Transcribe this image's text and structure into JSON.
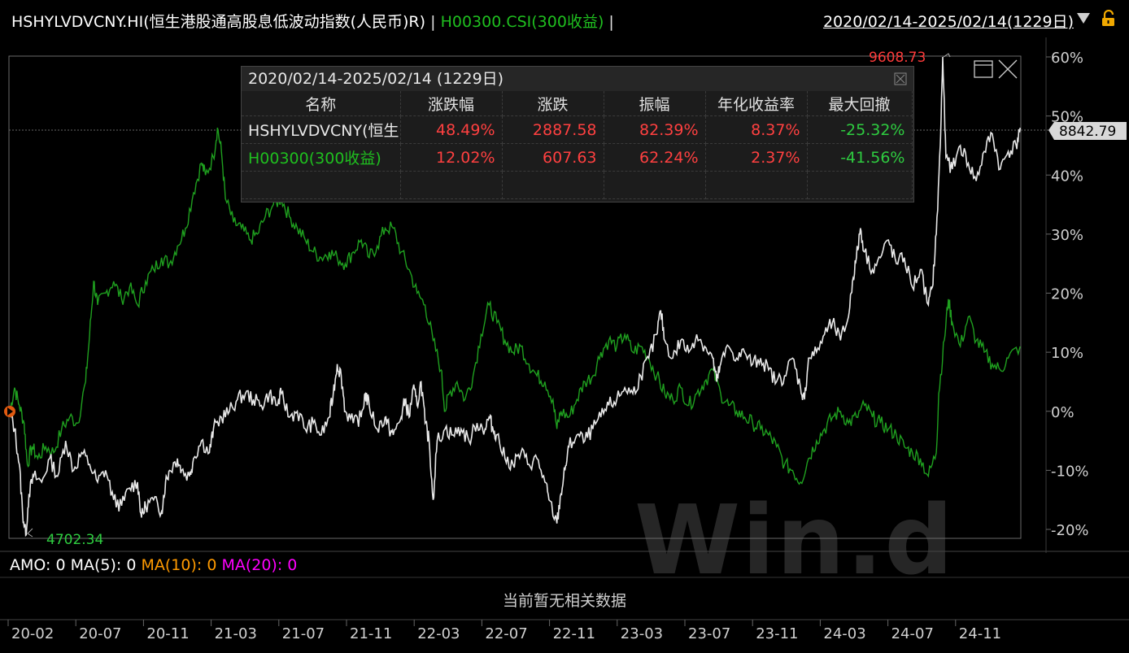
{
  "header": {
    "index_name": "HSHYLVDVCNY.HI(恒生港股通高股息低波动指数(人民币)R)",
    "sep1": "|",
    "benchmark": "H00300.CSI(300收益)",
    "sep2": "|",
    "date_range": "2020/02/14-2025/02/14(1229日)",
    "dropdown_icon": "triangle-down-icon",
    "lock_icon": "unlock-icon"
  },
  "panel": {
    "title": "2020/02/14-2025/02/14 (1229日)",
    "columns": [
      "名称",
      "涨跌幅",
      "涨跌",
      "振幅",
      "年化收益率",
      "最大回撤"
    ],
    "rows": [
      {
        "name": "HSHYLVDVCNY(恒生",
        "change_pct": "48.49%",
        "change": "2887.58",
        "amplitude": "82.39%",
        "annual": "8.37%",
        "max_dd": "-25.32%"
      },
      {
        "name": "H00300(300收益)",
        "change_pct": "12.02%",
        "change": "607.63",
        "amplitude": "62.24%",
        "annual": "2.37%",
        "max_dd": "-41.56%"
      }
    ]
  },
  "annotations": {
    "max_label": "9608.73",
    "min_label": "4702.34",
    "last_value": "8842.79"
  },
  "volume": {
    "amo": "AMO: 0",
    "ma5": "MA(5): 0",
    "ma10": "MA(10): 0",
    "ma20": "MA(20): 0",
    "no_data": "当前暂无相关数据"
  },
  "watermark": "Win.d",
  "colors": {
    "index": "#e8e8e8",
    "benchmark": "#1fa01f",
    "up": "#ff4040",
    "down": "#2ecc40",
    "axis": "#555555"
  },
  "chart_data": {
    "type": "line",
    "y_axis": {
      "min": -20,
      "max": 60,
      "ticks": [
        "60%",
        "50%",
        "40%",
        "30%",
        "20%",
        "10%",
        "0%",
        "-10%",
        "-20%"
      ]
    },
    "x_ticks": [
      "20-02",
      "20-07",
      "20-11",
      "21-03",
      "21-07",
      "21-11",
      "22-03",
      "22-07",
      "22-11",
      "23-03",
      "23-07",
      "23-11",
      "24-03",
      "24-07",
      "24-11"
    ],
    "series": [
      {
        "name": "HSHYLVDVCNY.HI",
        "unit": "%",
        "points": [
          [
            0,
            0
          ],
          [
            0.006,
            -3
          ],
          [
            0.012,
            -9
          ],
          [
            0.016,
            -17
          ],
          [
            0.02,
            -21
          ],
          [
            0.024,
            -14
          ],
          [
            0.03,
            -11
          ],
          [
            0.04,
            -12
          ],
          [
            0.05,
            -8
          ],
          [
            0.06,
            -11
          ],
          [
            0.07,
            -5
          ],
          [
            0.08,
            -10
          ],
          [
            0.09,
            -7
          ],
          [
            0.1,
            -9
          ],
          [
            0.11,
            -12
          ],
          [
            0.12,
            -10
          ],
          [
            0.13,
            -15
          ],
          [
            0.14,
            -16
          ],
          [
            0.15,
            -13
          ],
          [
            0.16,
            -12
          ],
          [
            0.165,
            -18
          ],
          [
            0.17,
            -16
          ],
          [
            0.18,
            -15
          ],
          [
            0.19,
            -17
          ],
          [
            0.195,
            -12
          ],
          [
            0.2,
            -10
          ],
          [
            0.21,
            -8
          ],
          [
            0.215,
            -10
          ],
          [
            0.225,
            -11
          ],
          [
            0.23,
            -8
          ],
          [
            0.24,
            -5
          ],
          [
            0.25,
            -7
          ],
          [
            0.255,
            -3
          ],
          [
            0.265,
            -1
          ],
          [
            0.275,
            0
          ],
          [
            0.285,
            2
          ],
          [
            0.295,
            3
          ],
          [
            0.305,
            2
          ],
          [
            0.315,
            1
          ],
          [
            0.325,
            3
          ],
          [
            0.335,
            1
          ],
          [
            0.34,
            3
          ],
          [
            0.35,
            -1
          ],
          [
            0.36,
            0
          ],
          [
            0.37,
            -3
          ],
          [
            0.38,
            -2
          ],
          [
            0.39,
            -4
          ],
          [
            0.4,
            -1
          ],
          [
            0.405,
            3
          ],
          [
            0.41,
            8
          ],
          [
            0.415,
            6
          ],
          [
            0.42,
            0
          ],
          [
            0.43,
            -2
          ],
          [
            0.44,
            -1
          ],
          [
            0.445,
            3
          ],
          [
            0.45,
            1
          ],
          [
            0.46,
            -3
          ],
          [
            0.47,
            -1
          ],
          [
            0.475,
            -3
          ],
          [
            0.48,
            -4
          ],
          [
            0.49,
            -1
          ],
          [
            0.495,
            2
          ],
          [
            0.5,
            -1
          ],
          [
            0.505,
            4
          ],
          [
            0.51,
            1
          ],
          [
            0.515,
            5
          ],
          [
            0.52,
            -2
          ],
          [
            0.525,
            -5
          ],
          [
            0.53,
            -15
          ],
          [
            0.535,
            -5
          ],
          [
            0.545,
            -3
          ],
          [
            0.555,
            -4
          ],
          [
            0.565,
            -3
          ],
          [
            0.575,
            -5
          ],
          [
            0.585,
            -2
          ],
          [
            0.595,
            -3
          ],
          [
            0.6,
            -1
          ],
          [
            0.605,
            -3
          ],
          [
            0.61,
            -4
          ],
          [
            0.62,
            -8
          ],
          [
            0.63,
            -9
          ],
          [
            0.64,
            -7
          ],
          [
            0.65,
            -9
          ],
          [
            0.66,
            -8
          ],
          [
            0.67,
            -12
          ],
          [
            0.675,
            -15
          ],
          [
            0.685,
            -19
          ],
          [
            0.69,
            -14
          ],
          [
            0.695,
            -10
          ],
          [
            0.7,
            -6
          ],
          [
            0.71,
            -4
          ],
          [
            0.72,
            -5
          ],
          [
            0.73,
            -3
          ],
          [
            0.74,
            -1
          ],
          [
            0.75,
            1
          ],
          [
            0.76,
            2
          ],
          [
            0.77,
            4
          ],
          [
            0.78,
            3
          ],
          [
            0.79,
            6
          ],
          [
            0.8,
            9
          ],
          [
            0.81,
            13
          ],
          [
            0.815,
            17
          ],
          [
            0.82,
            12
          ],
          [
            0.83,
            9
          ],
          [
            0.84,
            12
          ],
          [
            0.85,
            10
          ],
          [
            0.86,
            13
          ],
          [
            0.87,
            11
          ],
          [
            0.88,
            9
          ],
          [
            0.885,
            5
          ],
          [
            0.89,
            8
          ],
          [
            0.9,
            11
          ],
          [
            0.91,
            9
          ],
          [
            0.92,
            10
          ],
          [
            0.93,
            8
          ],
          [
            0.94,
            9
          ],
          [
            0.95,
            7
          ],
          [
            0.96,
            5
          ],
          [
            0.97,
            6
          ],
          [
            0.98,
            9
          ],
          [
            0.99,
            4
          ],
          [
            0.995,
            2
          ],
          [
            1.0,
            9
          ],
          [
            1.01,
            10
          ],
          [
            1.02,
            13
          ],
          [
            1.03,
            15
          ],
          [
            1.04,
            12
          ],
          [
            1.05,
            16
          ],
          [
            1.055,
            22
          ],
          [
            1.06,
            26
          ],
          [
            1.065,
            31
          ],
          [
            1.07,
            27
          ],
          [
            1.08,
            24
          ],
          [
            1.09,
            26
          ],
          [
            1.1,
            29
          ],
          [
            1.11,
            25
          ],
          [
            1.12,
            26
          ],
          [
            1.13,
            21
          ],
          [
            1.14,
            24
          ],
          [
            1.15,
            18
          ],
          [
            1.155,
            21
          ],
          [
            1.16,
            30
          ],
          [
            1.165,
            45
          ],
          [
            1.168,
            60
          ],
          [
            1.172,
            43
          ],
          [
            1.18,
            41
          ],
          [
            1.19,
            45
          ],
          [
            1.2,
            42
          ],
          [
            1.21,
            39
          ],
          [
            1.22,
            44
          ],
          [
            1.23,
            47
          ],
          [
            1.24,
            41
          ],
          [
            1.25,
            44
          ],
          [
            1.26,
            45
          ],
          [
            1.265,
            48
          ]
        ]
      },
      {
        "name": "H00300.CSI",
        "unit": "%",
        "points": [
          [
            0,
            0
          ],
          [
            0.006,
            4
          ],
          [
            0.012,
            1
          ],
          [
            0.018,
            -2
          ],
          [
            0.022,
            -9
          ],
          [
            0.028,
            -6
          ],
          [
            0.035,
            -8
          ],
          [
            0.045,
            -6
          ],
          [
            0.055,
            -7
          ],
          [
            0.065,
            -3
          ],
          [
            0.075,
            -1
          ],
          [
            0.085,
            -2
          ],
          [
            0.095,
            5
          ],
          [
            0.1,
            13
          ],
          [
            0.105,
            22
          ],
          [
            0.11,
            18
          ],
          [
            0.12,
            20
          ],
          [
            0.13,
            22
          ],
          [
            0.14,
            19
          ],
          [
            0.15,
            21
          ],
          [
            0.16,
            18
          ],
          [
            0.17,
            22
          ],
          [
            0.18,
            24
          ],
          [
            0.19,
            26
          ],
          [
            0.2,
            25
          ],
          [
            0.21,
            28
          ],
          [
            0.22,
            31
          ],
          [
            0.23,
            37
          ],
          [
            0.24,
            42
          ],
          [
            0.245,
            40
          ],
          [
            0.255,
            43
          ],
          [
            0.26,
            48
          ],
          [
            0.265,
            44
          ],
          [
            0.27,
            36
          ],
          [
            0.28,
            32
          ],
          [
            0.29,
            31
          ],
          [
            0.3,
            29
          ],
          [
            0.31,
            30
          ],
          [
            0.32,
            33
          ],
          [
            0.33,
            35
          ],
          [
            0.34,
            36
          ],
          [
            0.35,
            33
          ],
          [
            0.36,
            31
          ],
          [
            0.37,
            29
          ],
          [
            0.38,
            27
          ],
          [
            0.39,
            26
          ],
          [
            0.4,
            27
          ],
          [
            0.41,
            26
          ],
          [
            0.42,
            25
          ],
          [
            0.43,
            27
          ],
          [
            0.44,
            29
          ],
          [
            0.45,
            26
          ],
          [
            0.46,
            28
          ],
          [
            0.47,
            31
          ],
          [
            0.48,
            31
          ],
          [
            0.49,
            27
          ],
          [
            0.5,
            24
          ],
          [
            0.51,
            20
          ],
          [
            0.52,
            18
          ],
          [
            0.53,
            12
          ],
          [
            0.54,
            7
          ],
          [
            0.545,
            0
          ],
          [
            0.55,
            3
          ],
          [
            0.56,
            5
          ],
          [
            0.57,
            2
          ],
          [
            0.58,
            6
          ],
          [
            0.59,
            13
          ],
          [
            0.6,
            18
          ],
          [
            0.61,
            15
          ],
          [
            0.62,
            12
          ],
          [
            0.63,
            10
          ],
          [
            0.64,
            11
          ],
          [
            0.65,
            8
          ],
          [
            0.66,
            6
          ],
          [
            0.67,
            5
          ],
          [
            0.68,
            2
          ],
          [
            0.685,
            -3
          ],
          [
            0.69,
            0
          ],
          [
            0.7,
            -1
          ],
          [
            0.71,
            2
          ],
          [
            0.72,
            5
          ],
          [
            0.73,
            6
          ],
          [
            0.74,
            10
          ],
          [
            0.75,
            12
          ],
          [
            0.76,
            11
          ],
          [
            0.77,
            13
          ],
          [
            0.78,
            10
          ],
          [
            0.79,
            11
          ],
          [
            0.8,
            9
          ],
          [
            0.81,
            6
          ],
          [
            0.82,
            3
          ],
          [
            0.83,
            2
          ],
          [
            0.84,
            4
          ],
          [
            0.85,
            1
          ],
          [
            0.86,
            3
          ],
          [
            0.87,
            5
          ],
          [
            0.88,
            7
          ],
          [
            0.89,
            3
          ],
          [
            0.9,
            1
          ],
          [
            0.91,
            0
          ],
          [
            0.92,
            -1
          ],
          [
            0.93,
            -2
          ],
          [
            0.94,
            -3
          ],
          [
            0.95,
            -4
          ],
          [
            0.96,
            -6
          ],
          [
            0.97,
            -9
          ],
          [
            0.98,
            -10
          ],
          [
            0.99,
            -12
          ],
          [
            1.0,
            -8
          ],
          [
            1.01,
            -5
          ],
          [
            1.02,
            -3
          ],
          [
            1.03,
            -1
          ],
          [
            1.04,
            0
          ],
          [
            1.05,
            -2
          ],
          [
            1.06,
            -1
          ],
          [
            1.07,
            1
          ],
          [
            1.08,
            -1
          ],
          [
            1.09,
            -2
          ],
          [
            1.1,
            -3
          ],
          [
            1.11,
            -4
          ],
          [
            1.12,
            -6
          ],
          [
            1.13,
            -7
          ],
          [
            1.14,
            -8
          ],
          [
            1.15,
            -11
          ],
          [
            1.16,
            -7
          ],
          [
            1.163,
            3
          ],
          [
            1.17,
            12
          ],
          [
            1.175,
            19
          ],
          [
            1.18,
            15
          ],
          [
            1.19,
            11
          ],
          [
            1.2,
            16
          ],
          [
            1.21,
            12
          ],
          [
            1.22,
            10
          ],
          [
            1.23,
            8
          ],
          [
            1.24,
            7
          ],
          [
            1.25,
            9
          ],
          [
            1.265,
            11
          ]
        ]
      }
    ]
  }
}
